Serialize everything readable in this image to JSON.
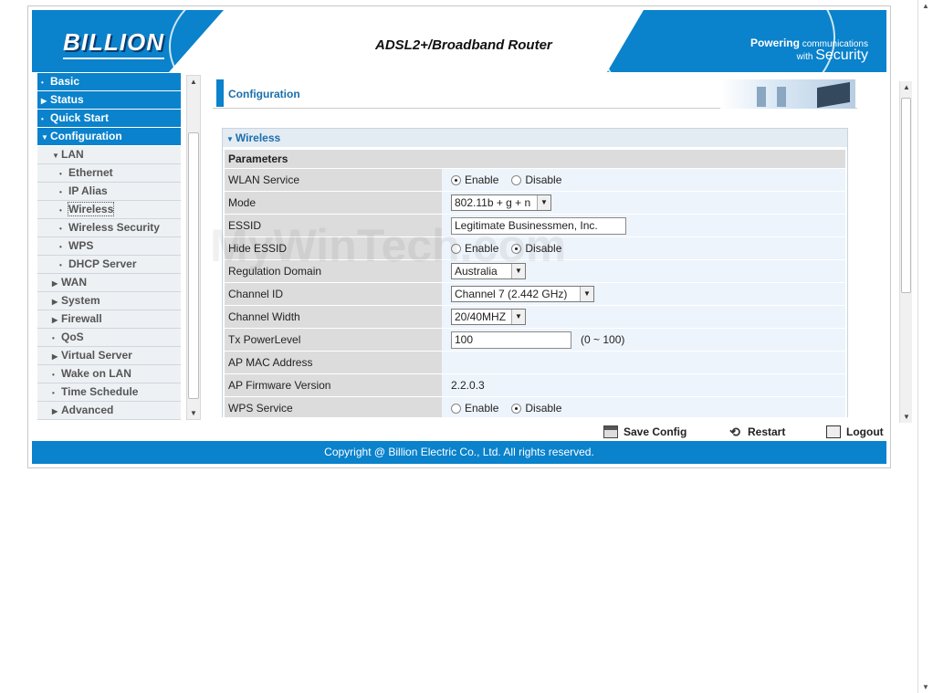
{
  "header": {
    "brand": "BILLION",
    "title": "ADSL2+/Broadband Router",
    "tagline_line1": "Powering",
    "tagline_line1b": "communications",
    "tagline_line2a": "with",
    "tagline_line2b": "Security"
  },
  "sidebar": {
    "items": [
      {
        "label": "Basic"
      },
      {
        "label": "Status"
      },
      {
        "label": "Quick Start"
      },
      {
        "label": "Configuration"
      },
      {
        "label": "LAN"
      },
      {
        "label": "Ethernet"
      },
      {
        "label": "IP Alias"
      },
      {
        "label": "Wireless"
      },
      {
        "label": "Wireless Security"
      },
      {
        "label": "WPS"
      },
      {
        "label": "DHCP Server"
      },
      {
        "label": "WAN"
      },
      {
        "label": "System"
      },
      {
        "label": "Firewall"
      },
      {
        "label": "QoS"
      },
      {
        "label": "Virtual Server"
      },
      {
        "label": "Wake on LAN"
      },
      {
        "label": "Time Schedule"
      },
      {
        "label": "Advanced"
      }
    ]
  },
  "main": {
    "section_title": "Configuration",
    "panel_title": "Wireless",
    "params_header": "Parameters",
    "rows": {
      "wlan_service": {
        "label": "WLAN Service",
        "opt1": "Enable",
        "opt2": "Disable"
      },
      "mode": {
        "label": "Mode",
        "value": "802.11b + g + n"
      },
      "essid": {
        "label": "ESSID",
        "value": "Legitimate Businessmen, Inc."
      },
      "hide_essid": {
        "label": "Hide ESSID",
        "opt1": "Enable",
        "opt2": "Disable"
      },
      "regulation": {
        "label": "Regulation Domain",
        "value": "Australia"
      },
      "channel_id": {
        "label": "Channel ID",
        "value": "Channel 7 (2.442 GHz)"
      },
      "channel_width": {
        "label": "Channel Width",
        "value": "20/40MHZ"
      },
      "tx_power": {
        "label": "Tx PowerLevel",
        "value": "100",
        "range": "(0 ~ 100)"
      },
      "ap_mac": {
        "label": "AP MAC Address"
      },
      "ap_fw": {
        "label": "AP Firmware Version",
        "value": "2.2.0.3"
      },
      "wps_service": {
        "label": "WPS Service",
        "opt1": "Enable",
        "opt2": "Disable"
      }
    }
  },
  "actions": {
    "save": "Save Config",
    "restart": "Restart",
    "logout": "Logout"
  },
  "footer": {
    "copyright": "Copyright @ Billion Electric Co., Ltd. All rights reserved."
  },
  "watermark": "MyWinTech.com"
}
